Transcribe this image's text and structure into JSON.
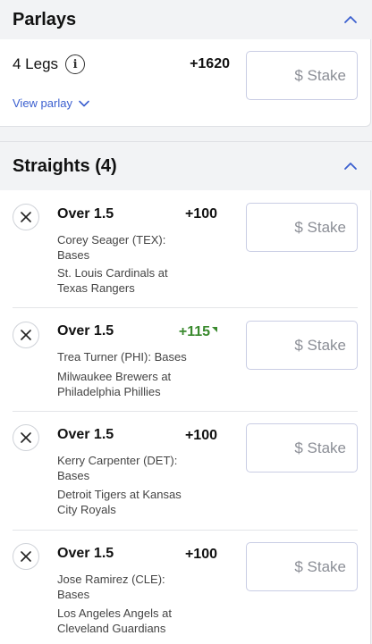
{
  "parlays": {
    "title": "Parlays",
    "legs_label": "4 Legs",
    "odds": "+1620",
    "stake_placeholder": "$ Stake",
    "view_parlay_label": "View parlay"
  },
  "straights": {
    "title": "Straights (4)",
    "bets": [
      {
        "line": "Over 1.5",
        "odds": "+100",
        "player": "Corey Seager (TEX): Bases",
        "game": "St. Louis Cardinals at Texas Rangers",
        "stake_placeholder": "$ Stake",
        "odds_up": false
      },
      {
        "line": "Over 1.5",
        "odds": "+115",
        "player": "Trea Turner (PHI): Bases",
        "game": "Milwaukee Brewers at Philadelphia Phillies",
        "stake_placeholder": "$ Stake",
        "odds_up": true
      },
      {
        "line": "Over 1.5",
        "odds": "+100",
        "player": "Kerry Carpenter (DET): Bases",
        "game": "Detroit Tigers at Kansas City Royals",
        "stake_placeholder": "$ Stake",
        "odds_up": false
      },
      {
        "line": "Over 1.5",
        "odds": "+100",
        "player": "Jose Ramirez (CLE): Bases",
        "game": "Los Angeles Angels at Cleveland Guardians",
        "stake_placeholder": "$ Stake",
        "odds_up": false
      }
    ]
  },
  "colors": {
    "accent": "#3b5fcf",
    "odds_up": "#3a8a2e",
    "background": "#f2f3f5"
  },
  "icons": {
    "collapse": "chevron-up-icon",
    "expand": "chevron-down-icon",
    "info": "info-icon",
    "remove": "close-icon"
  }
}
